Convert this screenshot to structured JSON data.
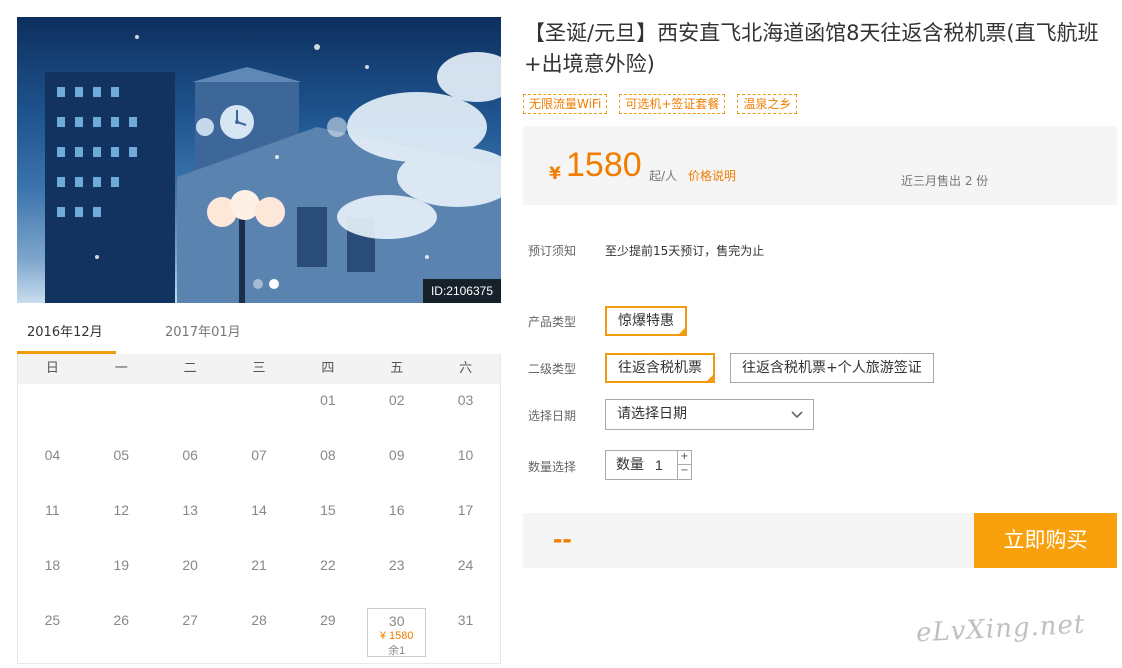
{
  "hero": {
    "id_badge": "ID:2106375",
    "dots": 2,
    "active_dot": 1
  },
  "calendar": {
    "months": [
      "2016年12月",
      "2017年01月"
    ],
    "active_month": 0,
    "weekdays": [
      "日",
      "一",
      "二",
      "三",
      "四",
      "五",
      "六"
    ],
    "leading_blanks": 4,
    "days": [
      "01",
      "02",
      "03",
      "04",
      "05",
      "06",
      "07",
      "08",
      "09",
      "10",
      "11",
      "12",
      "13",
      "14",
      "15",
      "16",
      "17",
      "18",
      "19",
      "20",
      "21",
      "22",
      "23",
      "24",
      "25",
      "26",
      "27",
      "28",
      "29",
      "30",
      "31"
    ],
    "available": {
      "day": "30",
      "price": "¥ 1580",
      "remaining": "余1"
    }
  },
  "product": {
    "title": "【圣诞/元旦】西安直飞北海道函馆8天往返含税机票(直飞航班+出境意外险)",
    "tags": [
      "无限流量WiFi",
      "可选机+签证套餐",
      "温泉之乡"
    ]
  },
  "price": {
    "currency": "¥",
    "amount": "1580",
    "unit": "起/人",
    "explain_link": "价格说明",
    "sold": "近三月售出 2 份"
  },
  "booking": {
    "notice_label": "预订须知",
    "notice_text": "至少提前15天预订，售完为止",
    "product_type_label": "产品类型",
    "product_type_option": "惊爆特惠",
    "sub_type_label": "二级类型",
    "sub_type_options": [
      "往返含税机票",
      "往返含税机票+个人旅游签证"
    ],
    "date_label": "选择日期",
    "date_placeholder": "请选择日期",
    "qty_label": "数量选择",
    "qty_inner_label": "数量",
    "qty_value": "1",
    "qty_plus": "+",
    "qty_minus": "−"
  },
  "buy": {
    "total": "--",
    "button": "立即购买"
  },
  "watermark": "eLvXing.net",
  "colors": {
    "accent": "#f39b0f",
    "price": "#f07d00",
    "buy": "#f8a10c"
  }
}
